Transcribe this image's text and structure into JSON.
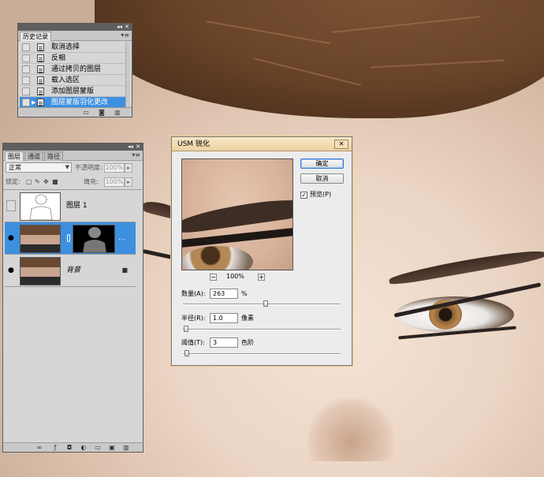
{
  "history_panel": {
    "tab": "历史记录",
    "items": [
      {
        "label": "取消选择"
      },
      {
        "label": "反相"
      },
      {
        "label": "通过拷贝的图层"
      },
      {
        "label": "载入选区"
      },
      {
        "label": "添加图层蒙版"
      },
      {
        "label": "图层蒙版羽化更改"
      }
    ]
  },
  "layers_panel": {
    "tabs": [
      "图层",
      "通道",
      "路径"
    ],
    "blend_mode": "正常",
    "opacity_label": "不透明度:",
    "opacity_value": "100%",
    "lock_label": "锁定:",
    "fill_label": "填充:",
    "fill_value": "100%",
    "layers": [
      {
        "name": "图层 1"
      },
      {
        "name": ""
      },
      {
        "name": "背景"
      }
    ]
  },
  "usm_dialog": {
    "title": "USM 锐化",
    "close_glyph": "✕",
    "ok_label": "确定",
    "cancel_label": "取消",
    "preview_label": "预览(P)",
    "preview_checked": "✓",
    "zoom_out": "−",
    "zoom_in": "+",
    "zoom_level": "100%",
    "amount_label": "数量(A):",
    "amount_value": "263",
    "amount_unit": "%",
    "amount_fraction": 0.53,
    "radius_label": "半径(R):",
    "radius_value": "1.0",
    "radius_unit": "像素",
    "radius_fraction": 0.003,
    "threshold_label": "阈值(T):",
    "threshold_value": "3",
    "threshold_unit": "色阶",
    "threshold_fraction": 0.012
  },
  "icons": {
    "collapse": "◂◂",
    "close": "✕",
    "menu": "▾≡",
    "eye": "●",
    "lock": "🔒",
    "play": "▶"
  }
}
